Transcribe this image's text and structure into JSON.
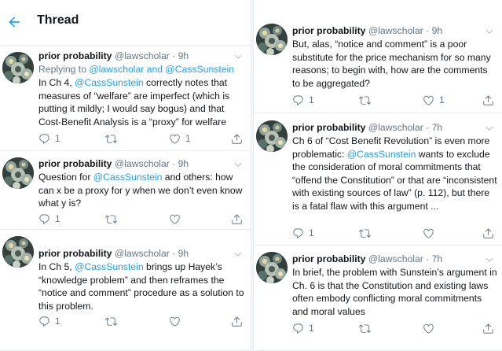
{
  "header": {
    "title": "Thread"
  },
  "left_tweets": [
    {
      "name": "prior probability",
      "handle": "@lawscholar",
      "dot": "·",
      "time": "9h",
      "reply_prefix": "Replying to ",
      "reply_to": "@lawscholar and @CassSunstein",
      "text": [
        {
          "t": "In Ch 4, "
        },
        {
          "t": "@CassSunstein",
          "m": true
        },
        {
          "t": " correctly notes that measures of “welfare” are imperfect (which is putting it mildly; I would say bogus) and that Cost-Benefit Analysis is a “proxy” for welfare"
        }
      ],
      "replies": "1",
      "retweets": "",
      "likes": "1"
    },
    {
      "name": "prior probability",
      "handle": "@lawscholar",
      "dot": "·",
      "time": "9h",
      "text": [
        {
          "t": "Question for "
        },
        {
          "t": "@CassSunstein",
          "m": true
        },
        {
          "t": " and others: how can x be a proxy for y when we don’t even know what y is?"
        }
      ],
      "replies": "1",
      "retweets": "",
      "likes": ""
    },
    {
      "name": "prior probability",
      "handle": "@lawscholar",
      "dot": "·",
      "time": "9h",
      "text": [
        {
          "t": "In Ch 5, "
        },
        {
          "t": "@CassSunstein",
          "m": true
        },
        {
          "t": " brings up Hayek’s “knowledge problem” and then reframes the “notice and comment” procedure as a solution to this problem."
        }
      ],
      "replies": "1",
      "retweets": "",
      "likes": ""
    }
  ],
  "right_tweets": [
    {
      "name": "prior probability",
      "handle": "@lawscholar",
      "dot": "·",
      "time": "9h",
      "text": [
        {
          "t": "But, alas, “notice and comment” is a poor substitute for the price mechanism for so many reasons; to begin with, how are the comments to be aggregated?"
        }
      ],
      "replies": "1",
      "retweets": "",
      "likes": "1"
    },
    {
      "name": "prior probability",
      "handle": "@lawscholar",
      "dot": "·",
      "time": "7h",
      "text": [
        {
          "t": "Ch 6 of “Cost Benefit Revolution” is even more problematic: "
        },
        {
          "t": "@CassSunstein",
          "m": true
        },
        {
          "t": " wants to exclude the consideration of moral commitments that “offend the Constitution” or that are “inconsistent with existing sources of law” (p. 112), but there is a fatal flaw with this argument ..."
        }
      ],
      "replies": "1",
      "retweets": "",
      "likes": ""
    },
    {
      "name": "prior probability",
      "handle": "@lawscholar",
      "dot": "·",
      "time": "7h",
      "text": [
        {
          "t": "In brief, the problem with Sunstein’s argument in Ch. 6 is that the Constitution and existing laws often embody conflicting moral commitments and moral values"
        }
      ],
      "replies": "1",
      "retweets": "",
      "likes": ""
    }
  ],
  "colors": {
    "accent": "#1da1f2",
    "text": "#14171a",
    "secondary": "#657786",
    "border": "#e6ecf0"
  },
  "icons": [
    "back-arrow-icon",
    "reply-icon",
    "retweet-icon",
    "like-icon",
    "share-icon",
    "chevron-down-icon"
  ]
}
